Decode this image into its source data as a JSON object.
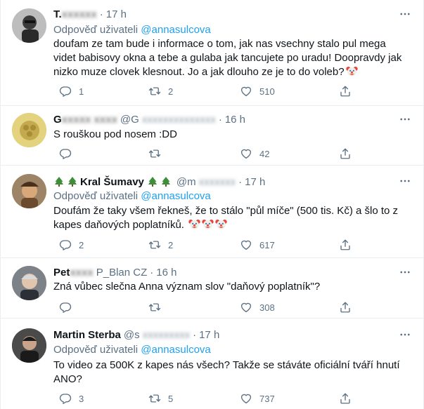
{
  "tweets": [
    {
      "name": "T. ",
      "handle": "",
      "time": "17 h",
      "reply_label": "Odpověď uživateli",
      "reply_handle": "@annasulcova",
      "text": "doufam ze tam bude i informace o tom, jak nas vsechny stalo pul mega videt babisovy okna a tebe a gulaba jak tancujete po uradu! Doopravdy jak nizko muze clovek klesnout. Jo a jak dlouho ze je to do voleb?",
      "replies": "1",
      "retweets": "2",
      "likes": "510"
    },
    {
      "name": "G",
      "handle": "@G",
      "time": "16 h",
      "text": "S rouškou pod nosem :DD",
      "replies": "",
      "retweets": "",
      "likes": "42"
    },
    {
      "name": "Kral Šumavy",
      "handle": "@m",
      "time": "17 h",
      "reply_label": "Odpověď uživateli",
      "reply_handle": "@annasulcova",
      "text": "Doufám že taky všem řekneš, že to stálo \"půl míče\" (500 tis. Kč) a šlo to z kapes daňových poplatníků.",
      "replies": "2",
      "retweets": "2",
      "likes": "617"
    },
    {
      "name": "Pet",
      "handle": "P_Blan CZ",
      "time": "16 h",
      "text": "Zná vůbec slečna Anna význam slov \"daňový poplatník\"?",
      "replies": "",
      "retweets": "",
      "likes": "308"
    },
    {
      "name": "Martin Sterba",
      "handle": "@s",
      "time": "17 h",
      "reply_label": "Odpověď uživateli",
      "reply_handle": "@annasulcova",
      "text": "To video za 500K z kapes nás všech? Takže se stáváte oficiální tváří hnutí ANO?",
      "replies": "3",
      "retweets": "5",
      "likes": "737"
    }
  ],
  "colors": {
    "link": "#1da1f2",
    "secondary": "#5b7083",
    "divider": "#ebeef0"
  },
  "icons": [
    "more-icon",
    "reply-icon",
    "retweet-icon",
    "like-icon",
    "share-icon",
    "clown-emoji",
    "tree-emoji"
  ]
}
